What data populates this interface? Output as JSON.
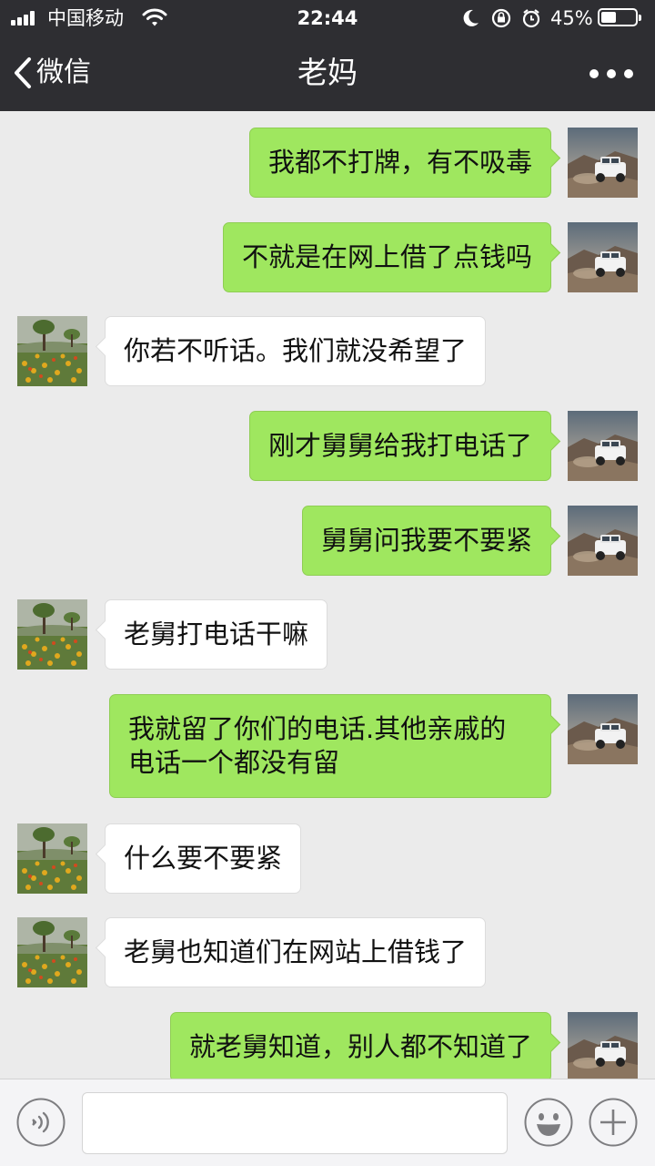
{
  "status_bar": {
    "carrier": "中国移动",
    "time": "22:44",
    "battery": "45%",
    "battery_level": 0.45
  },
  "nav": {
    "back_label": "微信",
    "title": "老妈"
  },
  "messages": [
    {
      "side": "me",
      "text": "我都不打牌，有不吸毒"
    },
    {
      "side": "me",
      "text": "不就是在网上借了点钱吗"
    },
    {
      "side": "other",
      "text": "你若不听话。我们就没希望了"
    },
    {
      "side": "me",
      "text": "刚才舅舅给我打电话了"
    },
    {
      "side": "me",
      "text": "舅舅问我要不要紧"
    },
    {
      "side": "other",
      "text": "老舅打电话干嘛"
    },
    {
      "side": "me",
      "text": "我就留了你们的电话.其他亲戚的电话一个都没有留"
    },
    {
      "side": "other",
      "text": "什么要不要紧"
    },
    {
      "side": "other",
      "text": "老舅也知道们在网站上借钱了"
    },
    {
      "side": "me",
      "text": "就老舅知道，别人都不知道了"
    }
  ],
  "colors": {
    "nav_bg": "#2e2e32",
    "chat_bg": "#ebebeb",
    "my_bubble": "#9fe75f",
    "their_bubble": "#ffffff"
  },
  "icons": {
    "back": "chevron-left-icon",
    "more": "more-dots-icon",
    "voice": "voice-icon",
    "emoji": "emoji-icon",
    "plus": "plus-icon"
  }
}
